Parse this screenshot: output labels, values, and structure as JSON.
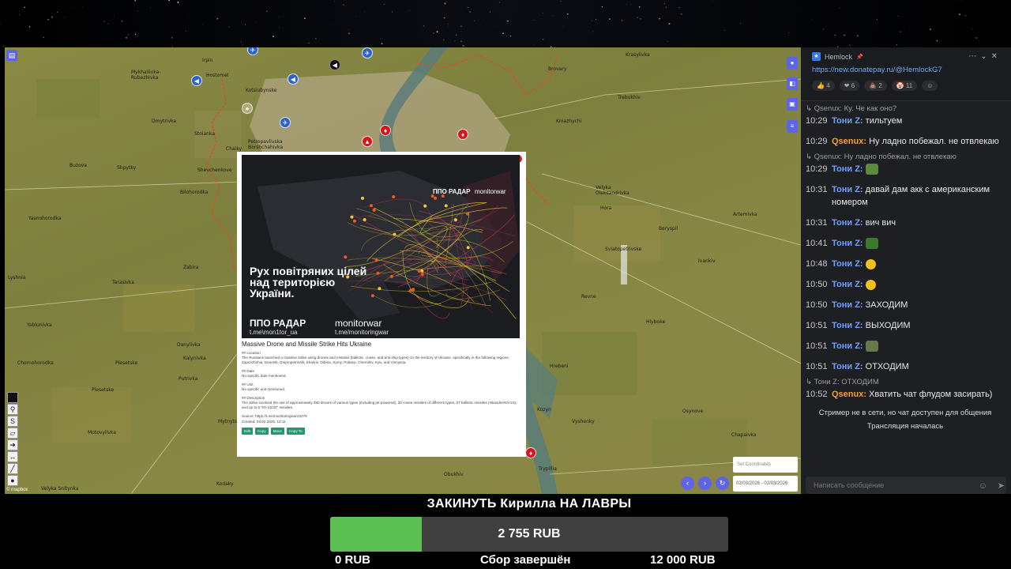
{
  "map": {
    "places": [
      {
        "t": "Irpin"
      },
      {
        "t": "Hostomel"
      },
      {
        "t": "Mykhailivka-\nRubezhivka"
      },
      {
        "t": "Kotsiubynske"
      },
      {
        "t": "Dmytrivka"
      },
      {
        "t": "Stoianka"
      },
      {
        "t": "Petropavlivska\nBorshchahivka"
      },
      {
        "t": "Chaiky"
      },
      {
        "t": "Buzova"
      },
      {
        "t": "Shpytky"
      },
      {
        "t": "Bilohorodka"
      },
      {
        "t": "Shevchenkove"
      },
      {
        "t": "Yasnohorodka"
      },
      {
        "t": "Zabira"
      },
      {
        "t": "Lyshnia"
      },
      {
        "t": "Tarasivka"
      },
      {
        "t": "Yablunivka"
      },
      {
        "t": "Danylivka"
      },
      {
        "t": "Kalynivka"
      },
      {
        "t": "Chornohorodka"
      },
      {
        "t": "Plesetske"
      },
      {
        "t": "Motovylivka"
      },
      {
        "t": "Mytnytsia"
      },
      {
        "t": "Kodaky"
      },
      {
        "t": "Velyka Snitynka"
      },
      {
        "t": "Brovary"
      },
      {
        "t": "Kniazhychi"
      },
      {
        "t": "Trebukhiv"
      },
      {
        "t": "Krasylivka"
      },
      {
        "t": "Hora"
      },
      {
        "t": "Velyka\nOleksandrivka"
      },
      {
        "t": "Boryspil"
      },
      {
        "t": "Artemivka"
      },
      {
        "t": "Ivankiv"
      },
      {
        "t": "Revne"
      },
      {
        "t": "Hlyboke"
      },
      {
        "t": "Osynove"
      },
      {
        "t": "Obukhiv"
      },
      {
        "t": "Trypillia"
      },
      {
        "t": "Kozyn"
      },
      {
        "t": "Vyshenky"
      },
      {
        "t": "Putrivka"
      },
      {
        "t": "Hrebeni"
      },
      {
        "t": "Plesetske"
      },
      {
        "t": "Sviatopetrivske"
      },
      {
        "t": "Chapaivka"
      }
    ],
    "mapbox": "© mapbox"
  },
  "popup": {
    "poster_title": "Рух повітряних цілей над територією України.",
    "poster_brand": "ППО РАДАР",
    "poster_partner": "monitorwar",
    "poster_link1": "t.me\\mon1tor_ua",
    "poster_link2": "t.me/monitoringwar",
    "poster_top_left": "ППО РАДАР",
    "poster_top_right": "monitorwar",
    "heading": "Massive Drone and Missile Strike Hits Ukraine",
    "location_h": "## Location",
    "location_t": "The Russians launched a massive strike using drones and missiles (ballistic, cruise, and anti-ship types) on the territory of Ukraine, specifically in the following regions: Zaporizhzhia, Donetsk, Dnipropetrovsk, Kharkiv, Odesa, Sumy, Poltava, Chernihiv, Kyiv, and Vinnytsia.",
    "date_h": "## Date",
    "date_t": "No specific date mentioned.",
    "unit_h": "## Unit",
    "unit_t": "No specific unit mentioned.",
    "desc_h": "## Description",
    "desc_t": "The strike involved the use of approximately 350 drones of various types (including jet-powered), 30 cruise missiles of different types, 27 ballistic missiles (Iskander/KN-23), and up to 6 \"Kh-22/32\" missiles.",
    "source": "Source: https://t.me/monitoringwar23279",
    "created": "Created: 03.02.2026, 12:11",
    "buttons": [
      "Edit",
      "Copy",
      "Move",
      "Copy To"
    ]
  },
  "controls": {
    "coords_placeholder": "Set Coordinates",
    "date_range": "02/03/2026 - 02/03/2026"
  },
  "chat": {
    "title": "Hemlock",
    "link": "https://new.donatepay.ru/@HemlockG7",
    "reactions": [
      {
        "icon": "👍",
        "count": "4"
      },
      {
        "icon": "❤",
        "count": "6"
      },
      {
        "icon": "💩",
        "count": "2"
      },
      {
        "icon": "🤡",
        "count": "11"
      }
    ],
    "reply1": "Qsenux: Ку. Че как оно?",
    "m1_ts": "10:29",
    "m1_name": "Тони Z:",
    "m1_text": "тильтуем",
    "m2_ts": "10:29",
    "m2_name": "Qsenux:",
    "m2_text": "Ну ладно побежал. не отвлекаю",
    "reply2": "Qsenux: Ну ладно побежал. не отвлекаю",
    "m3_ts": "10:29",
    "m3_name": "Тони Z:",
    "m4_ts": "10:31",
    "m4_name": "Тони Z:",
    "m4_text": "давай дам акк с американским номером",
    "m5_ts": "10:31",
    "m5_name": "Тони Z:",
    "m5_text": "вич вич",
    "m6_ts": "10:41",
    "m6_name": "Тони Z:",
    "m7_ts": "10:48",
    "m7_name": "Тони Z:",
    "m8_ts": "10:50",
    "m8_name": "Тони Z:",
    "m9_ts": "10:50",
    "m9_name": "Тони Z:",
    "m9_text": "ЗАХОДИМ",
    "m10_ts": "10:51",
    "m10_name": "Тони Z:",
    "m10_text": "ВЫХОДИМ",
    "m11_ts": "10:51",
    "m11_name": "Тони Z:",
    "m12_ts": "10:51",
    "m12_name": "Тони Z:",
    "m12_text": "ОТХОДИМ",
    "reply3": "Тони Z: ОТХОДИМ",
    "m13_ts": "10:52",
    "m13_name": "Qsenux:",
    "m13_text": "Хватить чат флудом засирать)",
    "sys1": "Стример не в сети, но чат доступен для общения",
    "sys2": "Трансляция началась",
    "input_placeholder": "Написать сообщение"
  },
  "donation": {
    "title": "ЗАКИНУТЬ Кирилла НА ЛАВРЫ",
    "current": "2 755 RUB",
    "min": "0 RUB",
    "status": "Сбор завершён",
    "goal": "12 000 RUB",
    "progress": 0.23,
    "fill_color": "#5bbf52"
  }
}
